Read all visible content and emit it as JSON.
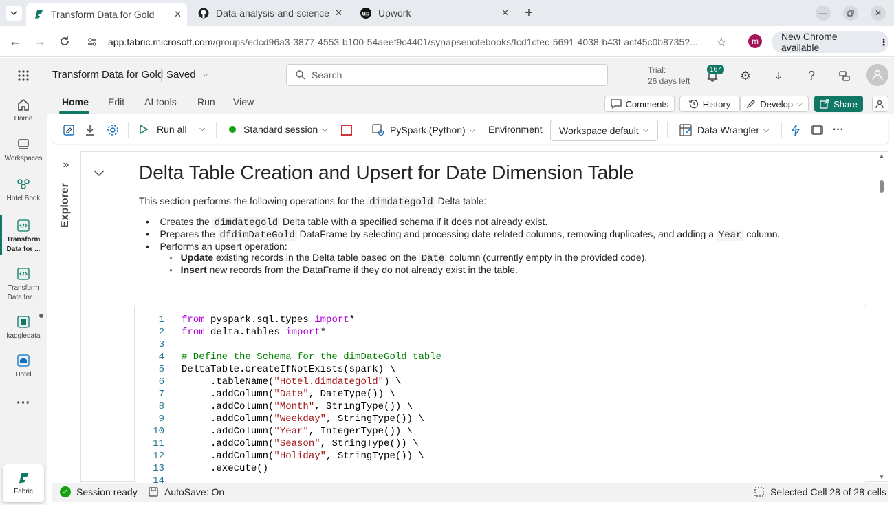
{
  "browser": {
    "tabs": [
      {
        "title": "Transform Data for Gold",
        "active": true
      },
      {
        "title": "Data-analysis-and-science",
        "active": false
      },
      {
        "title": "Upwork",
        "active": false
      }
    ],
    "url_host": "app.fabric.microsoft.com",
    "url_path": "/groups/edcd96a3-3877-4553-b100-54aeef9c4401/synapsenotebooks/fcd1cfec-5691-4038-b43f-acf45c0b8735?...",
    "profile_initial": "m",
    "update_label": "New Chrome available"
  },
  "app": {
    "notebook_name": "Transform Data for Gold",
    "save_state": "Saved",
    "search_placeholder": "Search",
    "trial_line1": "Trial:",
    "trial_line2": "26 days left",
    "notification_count": "167"
  },
  "rail": {
    "items": [
      {
        "label": "Home",
        "icon": "home-icon"
      },
      {
        "label": "Workspaces",
        "icon": "workspaces-icon"
      },
      {
        "label": "Hotel Book",
        "icon": "hotel-book-icon"
      },
      {
        "label": "Transform Data for ...",
        "icon": "notebook-icon"
      },
      {
        "label": "Transform Data for ...",
        "icon": "notebook-icon"
      },
      {
        "label": "kaggledata",
        "icon": "lakehouse-icon"
      },
      {
        "label": "Hotel",
        "icon": "warehouse-icon"
      }
    ],
    "bottom_label": "Fabric"
  },
  "ribbon": {
    "tabs": [
      "Home",
      "Edit",
      "AI tools",
      "Run",
      "View"
    ],
    "comments": "Comments",
    "history": "History",
    "develop": "Develop",
    "share": "Share",
    "run_all": "Run all",
    "session": "Standard session",
    "language": "PySpark (Python)",
    "environment_label": "Environment",
    "environment_value": "Workspace default",
    "data_wrangler": "Data Wrangler"
  },
  "explorer_label": "Explorer",
  "markdown": {
    "heading": "Delta Table Creation and Upsert for Date Dimension Table",
    "intro_pre": "This section performs the following operations for the",
    "intro_code": "dimdategold",
    "intro_post": "Delta table:",
    "b1_pre": "Creates the",
    "b1_code": "dimdategold",
    "b1_post": "Delta table with a specified schema if it does not already exist.",
    "b2_pre": "Prepares the",
    "b2_code": "dfdimDateGold",
    "b2_mid": "DataFrame by selecting and processing date-related columns, removing duplicates, and adding a",
    "b2_code2": "Year",
    "b2_post": "column.",
    "b3": "Performs an upsert operation:",
    "s1_bold": "Update",
    "s1_pre": "existing records in the Delta table based on the",
    "s1_code": "Date",
    "s1_post": "column (currently empty in the provided code).",
    "s2_bold": "Insert",
    "s2_post": "new records from the DataFrame if they do not already exist in the table."
  },
  "code": {
    "line_numbers": [
      "1",
      "2",
      "3",
      "4",
      "5",
      "6",
      "7",
      "8",
      "9",
      "10",
      "11",
      "12",
      "13",
      "14"
    ],
    "l1a": "from",
    "l1b": " pyspark.sql.types ",
    "l1c": "import",
    "l1d": "*",
    "l2a": "from",
    "l2b": " delta.tables ",
    "l2c": "import",
    "l2d": "*",
    "l4": "# Define the Schema for the dimDateGold table",
    "l5": "DeltaTable.createIfNotExists(spark) \\",
    "l6a": "     .tableName(",
    "l6b": "\"Hotel.dimdategold\"",
    "l6c": ") \\",
    "l7a": "     .addColumn(",
    "l7b": "\"Date\"",
    "l7c": ", DateType()) \\",
    "l8a": "     .addColumn(",
    "l8b": "\"Month\"",
    "l8c": ", StringType()) \\",
    "l9a": "     .addColumn(",
    "l9b": "\"Weekday\"",
    "l9c": ", StringType()) \\",
    "l10a": "     .addColumn(",
    "l10b": "\"Year\"",
    "l10c": ", IntegerType()) \\",
    "l11a": "     .addColumn(",
    "l11b": "\"Season\"",
    "l11c": ", StringType()) \\",
    "l12a": "     .addColumn(",
    "l12b": "\"Holiday\"",
    "l12c": ", StringType()) \\",
    "l13": "     .execute()"
  },
  "status": {
    "session": "Session ready",
    "autosave": "AutoSave: On",
    "selection": "Selected Cell 28 of 28 cells"
  },
  "colors": {
    "accent": "#117865",
    "fabric_green": "#0f7b5f",
    "tab_bg": "#e7ebf0"
  }
}
